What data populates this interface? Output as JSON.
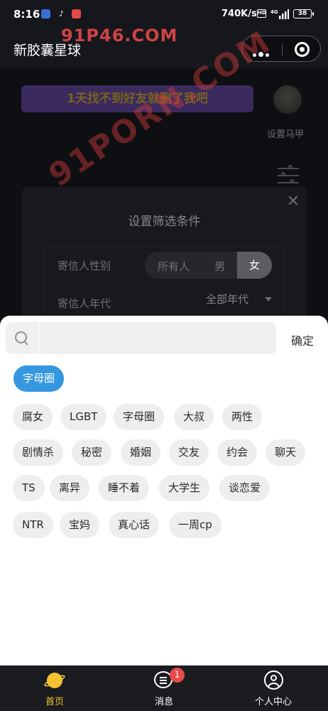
{
  "status_bar": {
    "time": "8:16",
    "speed": "740K/s",
    "hd": "HD",
    "network": "4G",
    "battery": "38"
  },
  "nav": {
    "title": "新胶囊星球"
  },
  "page": {
    "banner_text": "1天找不到好友就删了我吧",
    "avatar_label": "设置马甲"
  },
  "filter_dialog": {
    "title": "设置筛选条件",
    "gender_label": "寄信人性别",
    "gender_options": [
      "所有人",
      "男",
      "女"
    ],
    "gender_selected": "女",
    "age_label": "寄信人年代",
    "age_value": "全部年代"
  },
  "watermarks": [
    "91P46.COM",
    "91PORN.COM"
  ],
  "sheet": {
    "search_placeholder": "",
    "confirm_label": "确定",
    "selected_tag": "字母圈",
    "tags": [
      "腐女",
      "LGBT",
      "字母圈",
      "大叔",
      "两性",
      "剧情杀",
      "秘密",
      "婚姻",
      "交友",
      "约会",
      "聊天",
      "TS",
      "离异",
      "睡不着",
      "大学生",
      "谈恋爱",
      "NTR",
      "宝妈",
      "真心话",
      "一周cp"
    ]
  },
  "tabbar": {
    "tabs": [
      {
        "label": "首页",
        "icon": "planet-icon",
        "active": true
      },
      {
        "label": "消息",
        "icon": "message-icon",
        "badge": "1"
      },
      {
        "label": "个人中心",
        "icon": "person-icon"
      }
    ]
  },
  "colors": {
    "accent": "#3497e0",
    "tab_active": "#f2c230",
    "badge": "#e84a4a"
  }
}
